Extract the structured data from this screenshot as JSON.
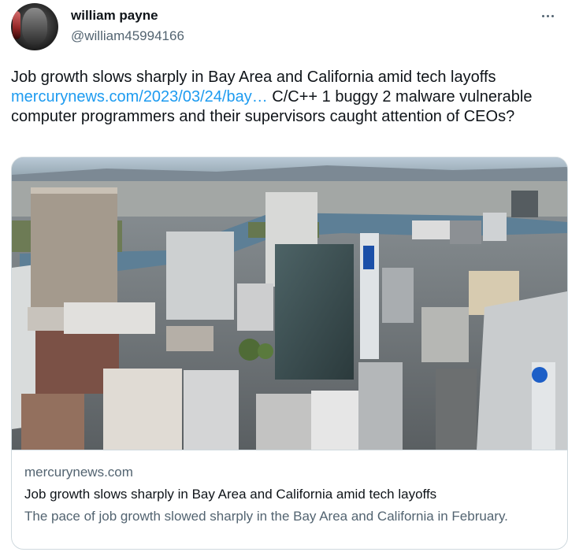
{
  "author": {
    "display_name": "william payne",
    "handle": "@william45994166"
  },
  "icons": {
    "more": "more-horizontal-icon",
    "avatar": "profile-avatar"
  },
  "tweet": {
    "text_prefix": "Job growth slows sharply in Bay Area and California amid tech layoffs",
    "link_text": "mercurynews.com/2023/03/24/bay…",
    "text_suffix": " C/C++ 1 buggy 2 malware vulnerable computer programmers and their supervisors caught attention of CEOs?"
  },
  "card": {
    "domain": "mercurynews.com",
    "title": "Job growth slows sharply in Bay Area and California amid tech layoffs",
    "description": "The pace of job growth slowed sharply in the Bay Area and California in February."
  },
  "colors": {
    "link": "#1d9bf0",
    "secondary_text": "#536471",
    "border": "#cfd9de"
  }
}
